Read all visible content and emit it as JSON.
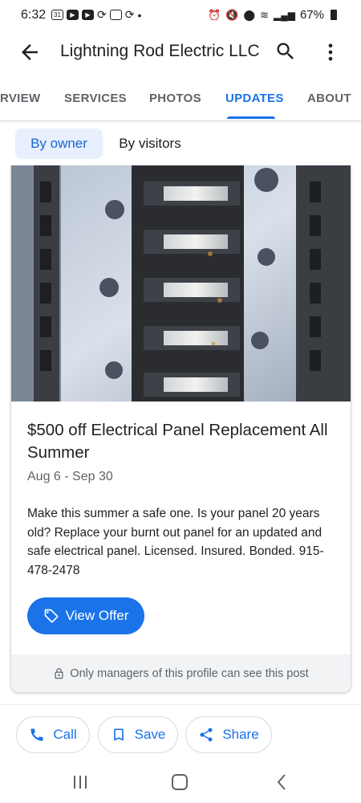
{
  "status_bar": {
    "time": "6:32",
    "calendar_day": "31",
    "battery": "67%"
  },
  "header": {
    "title": "Lightning Rod Electric LLC"
  },
  "tabs": [
    {
      "label": "RVIEW",
      "active": false
    },
    {
      "label": "SERVICES",
      "active": false
    },
    {
      "label": "PHOTOS",
      "active": false
    },
    {
      "label": "UPDATES",
      "active": true
    },
    {
      "label": "ABOUT",
      "active": false
    }
  ],
  "filters": {
    "owner": "By owner",
    "visitors": "By visitors",
    "selected": "By owner"
  },
  "post": {
    "title": "$500 off Electrical Panel Replacement All Summer",
    "date_range": "Aug 6 - Sep 30",
    "body": "Make this summer a safe one. Is your panel 20 years old? Replace your burnt out panel for an updated and safe electrical panel. Licensed. Insured. Bonded. 915-478-2478",
    "cta_label": "View Offer",
    "footer_note": "Only managers of this profile can see this post"
  },
  "actions": {
    "call": "Call",
    "save": "Save",
    "share": "Share"
  },
  "colors": {
    "accent": "#1a73e8",
    "chip_bg": "#e8f0fe",
    "footer_bg": "#f1f3f4"
  }
}
